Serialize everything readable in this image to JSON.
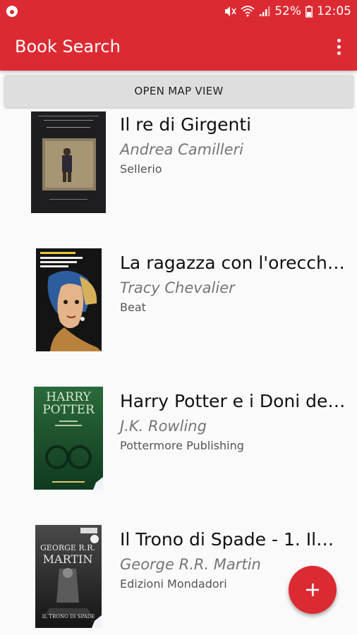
{
  "status_bar": {
    "battery_percent": "52%",
    "time": "12:05",
    "icons": [
      "app-notification-icon",
      "mute-icon",
      "wifi-icon",
      "signal-icon",
      "battery-icon"
    ]
  },
  "app_bar": {
    "title": "Book Search",
    "menu_icon": "more-vertical-icon"
  },
  "map_button": {
    "label": "OPEN MAP VIEW"
  },
  "books": [
    {
      "title": "Il re di Girgenti",
      "author": "Andrea Camilleri",
      "publisher": "Sellerio"
    },
    {
      "title": "La ragazza con l'orecchi…",
      "author": "Tracy Chevalier",
      "publisher": "Beat"
    },
    {
      "title": "Harry Potter e i Doni de…",
      "author": "J.K. Rowling",
      "publisher": "Pottermore Publishing"
    },
    {
      "title": "Il Trono di Spade - 1. Il…",
      "author": "George R.R. Martin",
      "publisher": "Edizioni Mondadori"
    }
  ],
  "fab": {
    "icon": "add-icon"
  },
  "colors": {
    "primary": "#dc2a32",
    "background": "#fafafa",
    "button": "#dedede"
  }
}
